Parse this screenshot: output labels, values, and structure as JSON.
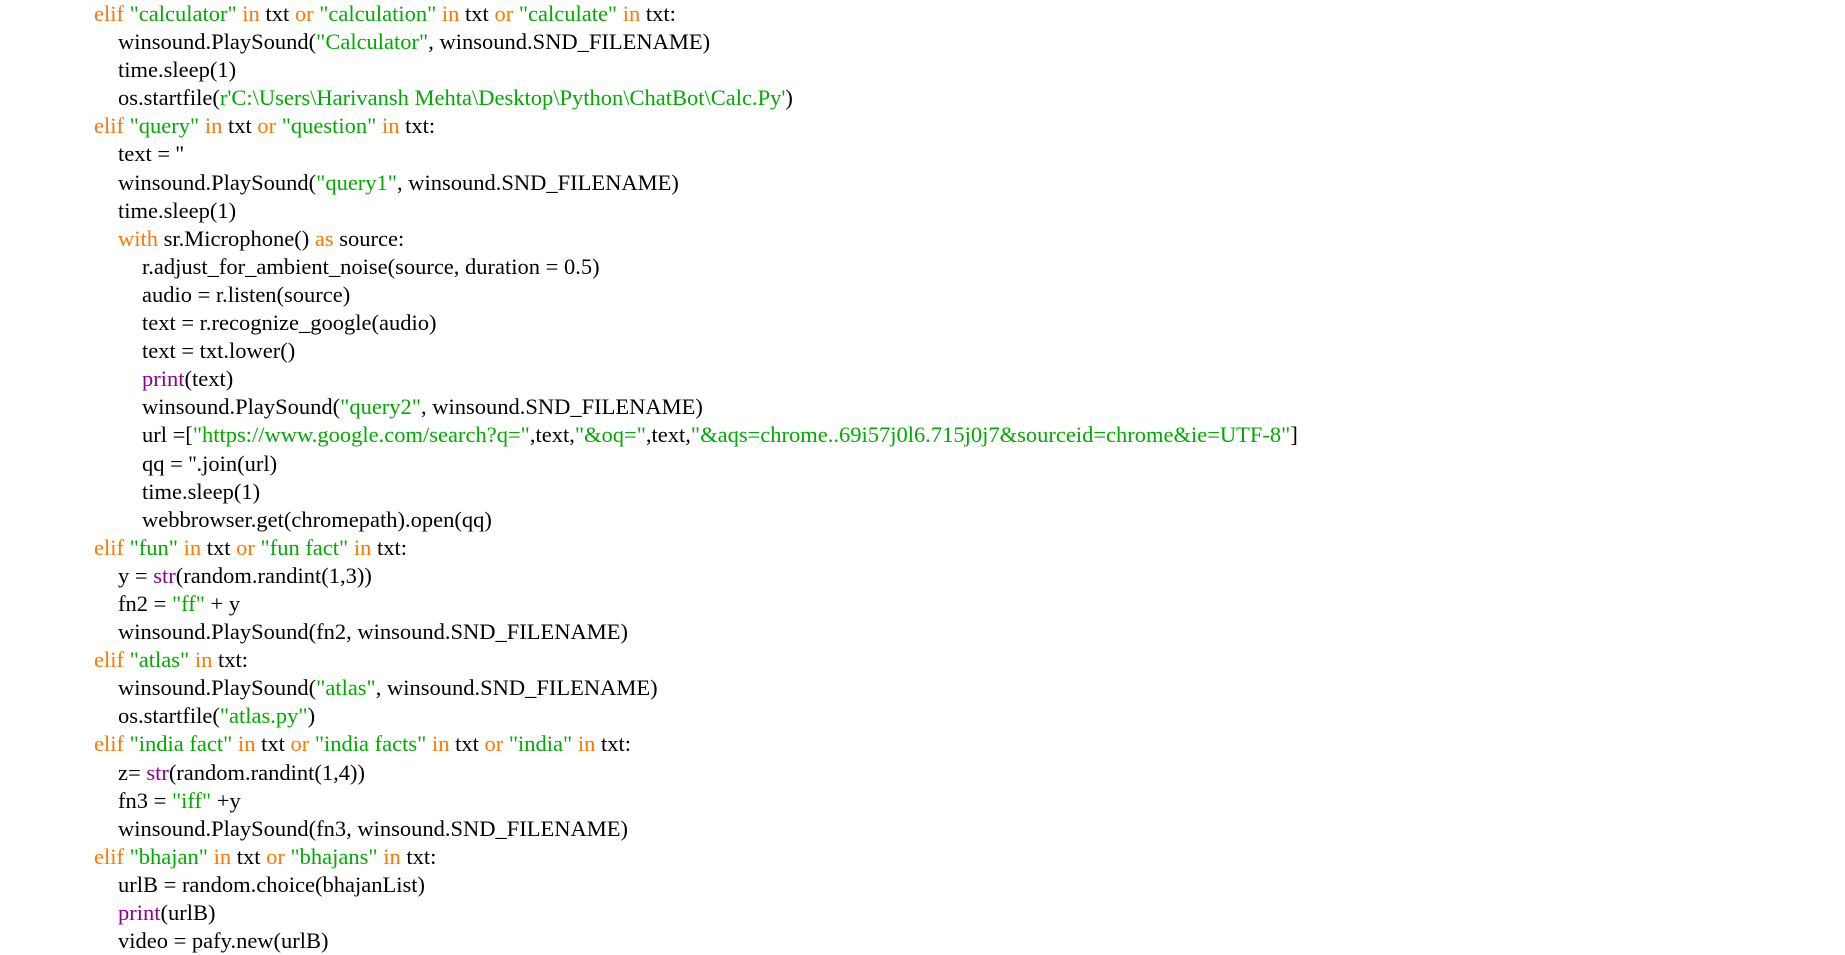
{
  "colors": {
    "background": "#ffffff",
    "text": "#000000",
    "keyword": "#ff7700",
    "string": "#00aa00",
    "builtin": "#900090"
  },
  "lines": [
    {
      "indent": 0,
      "tokens": [
        [
          "kw",
          "elif "
        ],
        [
          "str",
          "\"calculator\""
        ],
        [
          "kw",
          " in "
        ],
        [
          "txt",
          "txt "
        ],
        [
          "kw",
          "or "
        ],
        [
          "str",
          "\"calculation\""
        ],
        [
          "kw",
          " in "
        ],
        [
          "txt",
          "txt "
        ],
        [
          "kw",
          "or "
        ],
        [
          "str",
          "\"calculate\""
        ],
        [
          "kw",
          " in "
        ],
        [
          "txt",
          "txt:"
        ]
      ]
    },
    {
      "indent": 1,
      "tokens": [
        [
          "txt",
          "winsound.PlaySound("
        ],
        [
          "str",
          "\"Calculator\""
        ],
        [
          "txt",
          ", winsound.SND_FILENAME)"
        ]
      ]
    },
    {
      "indent": 1,
      "tokens": [
        [
          "txt",
          "time.sleep(1)"
        ]
      ]
    },
    {
      "indent": 1,
      "tokens": [
        [
          "txt",
          "os.startfile("
        ],
        [
          "str",
          "r'C:\\Users\\Harivansh Mehta\\Desktop\\Python\\ChatBot\\Calc.Py'"
        ],
        [
          "txt",
          ")"
        ]
      ]
    },
    {
      "indent": 0,
      "tokens": [
        [
          "kw",
          "elif "
        ],
        [
          "str",
          "\"query\""
        ],
        [
          "kw",
          " in "
        ],
        [
          "txt",
          "txt "
        ],
        [
          "kw",
          "or "
        ],
        [
          "str",
          "\"question\""
        ],
        [
          "kw",
          " in "
        ],
        [
          "txt",
          "txt:"
        ]
      ]
    },
    {
      "indent": 1,
      "tokens": [
        [
          "txt",
          "text = ''"
        ]
      ]
    },
    {
      "indent": 1,
      "tokens": [
        [
          "txt",
          "winsound.PlaySound("
        ],
        [
          "str",
          "\"query1\""
        ],
        [
          "txt",
          ", winsound.SND_FILENAME)"
        ]
      ]
    },
    {
      "indent": 1,
      "tokens": [
        [
          "txt",
          "time.sleep(1)"
        ]
      ]
    },
    {
      "indent": 1,
      "tokens": [
        [
          "kw",
          "with "
        ],
        [
          "txt",
          "sr.Microphone() "
        ],
        [
          "kw",
          "as "
        ],
        [
          "txt",
          "source:"
        ]
      ]
    },
    {
      "indent": 2,
      "tokens": [
        [
          "txt",
          "r.adjust_for_ambient_noise(source, duration = 0.5)"
        ]
      ]
    },
    {
      "indent": 2,
      "tokens": [
        [
          "txt",
          "audio = r.listen(source)"
        ]
      ]
    },
    {
      "indent": 2,
      "tokens": [
        [
          "txt",
          "text = r.recognize_google(audio)"
        ]
      ]
    },
    {
      "indent": 2,
      "tokens": [
        [
          "txt",
          "text = txt.lower()"
        ]
      ]
    },
    {
      "indent": 2,
      "tokens": [
        [
          "bi",
          "print"
        ],
        [
          "txt",
          "(text)"
        ]
      ]
    },
    {
      "indent": 2,
      "tokens": [
        [
          "txt",
          "winsound.PlaySound("
        ],
        [
          "str",
          "\"query2\""
        ],
        [
          "txt",
          ", winsound.SND_FILENAME)"
        ]
      ]
    },
    {
      "indent": 2,
      "tokens": [
        [
          "txt",
          "url =["
        ],
        [
          "str",
          "\"https://www.google.com/search?q=\""
        ],
        [
          "txt",
          ",text,"
        ],
        [
          "str",
          "\"&oq=\""
        ],
        [
          "txt",
          ",text,"
        ],
        [
          "str",
          "\"&aqs=chrome..69i57j0l6.715j0j7&sourceid=chrome&ie=UTF-8\""
        ],
        [
          "txt",
          "]"
        ]
      ]
    },
    {
      "indent": 2,
      "tokens": [
        [
          "txt",
          "qq = ''.join(url)"
        ]
      ]
    },
    {
      "indent": 2,
      "tokens": [
        [
          "txt",
          "time.sleep(1)"
        ]
      ]
    },
    {
      "indent": 2,
      "tokens": [
        [
          "txt",
          "webbrowser.get(chromepath).open(qq)"
        ]
      ]
    },
    {
      "indent": 0,
      "tokens": [
        [
          "kw",
          "elif "
        ],
        [
          "str",
          "\"fun\""
        ],
        [
          "kw",
          " in "
        ],
        [
          "txt",
          "txt "
        ],
        [
          "kw",
          "or "
        ],
        [
          "str",
          "\"fun fact\""
        ],
        [
          "kw",
          " in "
        ],
        [
          "txt",
          "txt:"
        ]
      ]
    },
    {
      "indent": 1,
      "tokens": [
        [
          "txt",
          "y = "
        ],
        [
          "bi",
          "str"
        ],
        [
          "txt",
          "(random.randint(1,3))"
        ]
      ]
    },
    {
      "indent": 1,
      "tokens": [
        [
          "txt",
          "fn2 = "
        ],
        [
          "str",
          "\"ff\""
        ],
        [
          "txt",
          " + y"
        ]
      ]
    },
    {
      "indent": 1,
      "tokens": [
        [
          "txt",
          "winsound.PlaySound(fn2, winsound.SND_FILENAME)"
        ]
      ]
    },
    {
      "indent": 0,
      "tokens": [
        [
          "kw",
          "elif "
        ],
        [
          "str",
          "\"atlas\""
        ],
        [
          "kw",
          " in "
        ],
        [
          "txt",
          "txt:"
        ]
      ]
    },
    {
      "indent": 1,
      "tokens": [
        [
          "txt",
          "winsound.PlaySound("
        ],
        [
          "str",
          "\"atlas\""
        ],
        [
          "txt",
          ", winsound.SND_FILENAME)"
        ]
      ]
    },
    {
      "indent": 1,
      "tokens": [
        [
          "txt",
          "os.startfile("
        ],
        [
          "str",
          "\"atlas.py\""
        ],
        [
          "txt",
          ")"
        ]
      ]
    },
    {
      "indent": 0,
      "tokens": [
        [
          "kw",
          "elif "
        ],
        [
          "str",
          "\"india fact\""
        ],
        [
          "kw",
          " in "
        ],
        [
          "txt",
          "txt "
        ],
        [
          "kw",
          "or "
        ],
        [
          "str",
          "\"india facts\""
        ],
        [
          "kw",
          " in "
        ],
        [
          "txt",
          "txt "
        ],
        [
          "kw",
          "or "
        ],
        [
          "str",
          "\"india\""
        ],
        [
          "kw",
          " in "
        ],
        [
          "txt",
          "txt:"
        ]
      ]
    },
    {
      "indent": 1,
      "tokens": [
        [
          "txt",
          "z= "
        ],
        [
          "bi",
          "str"
        ],
        [
          "txt",
          "(random.randint(1,4))"
        ]
      ]
    },
    {
      "indent": 1,
      "tokens": [
        [
          "txt",
          "fn3 = "
        ],
        [
          "str",
          "\"iff\""
        ],
        [
          "txt",
          " +y"
        ]
      ]
    },
    {
      "indent": 1,
      "tokens": [
        [
          "txt",
          "winsound.PlaySound(fn3, winsound.SND_FILENAME)"
        ]
      ]
    },
    {
      "indent": 0,
      "tokens": [
        [
          "kw",
          "elif "
        ],
        [
          "str",
          "\"bhajan\""
        ],
        [
          "kw",
          " in "
        ],
        [
          "txt",
          "txt "
        ],
        [
          "kw",
          "or "
        ],
        [
          "str",
          "\"bhajans\""
        ],
        [
          "kw",
          " in "
        ],
        [
          "txt",
          "txt:"
        ]
      ]
    },
    {
      "indent": 1,
      "tokens": [
        [
          "txt",
          "urlB = random.choice(bhajanList)"
        ]
      ]
    },
    {
      "indent": 1,
      "tokens": [
        [
          "bi",
          "print"
        ],
        [
          "txt",
          "(urlB)"
        ]
      ]
    },
    {
      "indent": 1,
      "tokens": [
        [
          "txt",
          "video = pafy.new(urlB)"
        ]
      ]
    }
  ]
}
